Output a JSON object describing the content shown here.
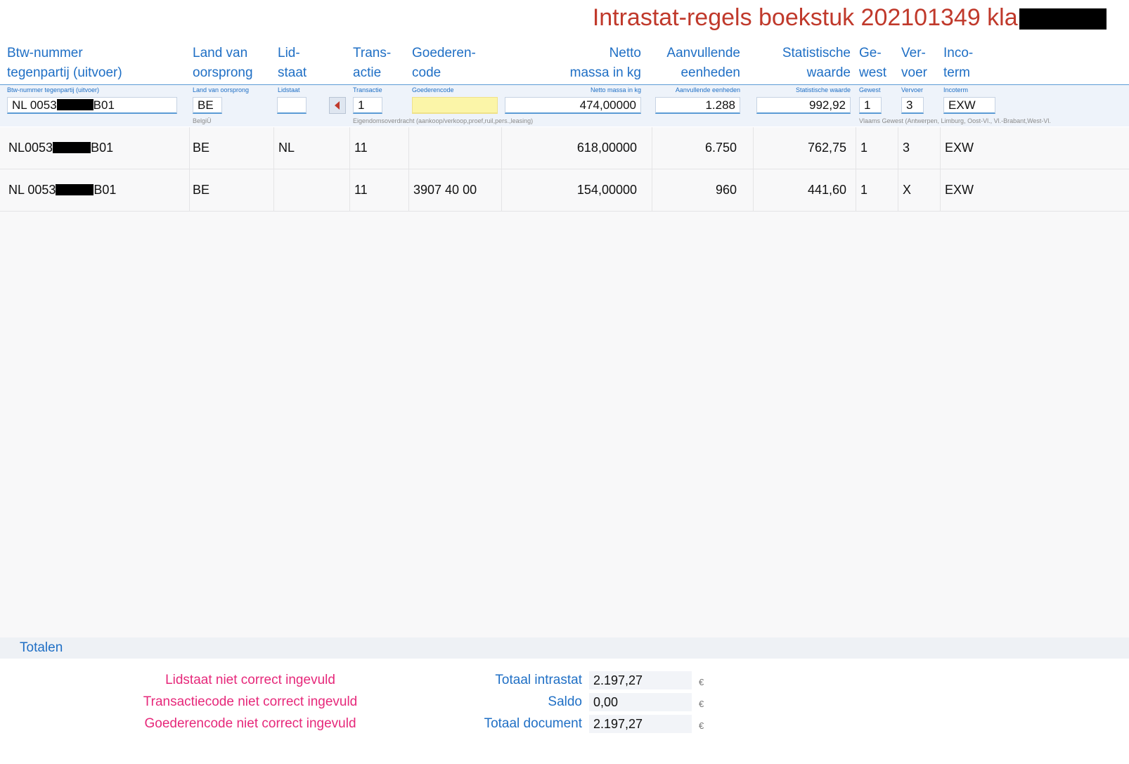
{
  "title": "Intrastat-regels boekstuk 202101349  klant",
  "columns": {
    "btw": {
      "line1": "Btw-nummer",
      "line2": "tegenpartij (uitvoer)",
      "mini": "Btw-nummer tegenpartij (uitvoer)"
    },
    "land": {
      "line1": "Land van",
      "line2": "oorsprong",
      "mini": "Land van oorsprong"
    },
    "lidstaat": {
      "line1": "Lid-",
      "line2": "staat",
      "mini": "Lidstaat"
    },
    "transactie": {
      "line1": "Trans-",
      "line2": "actie",
      "mini": "Transactie"
    },
    "goederencode": {
      "line1": "Goederen-",
      "line2": "code",
      "mini": "Goederencode"
    },
    "netto": {
      "line1": "Netto",
      "line2": "massa in kg",
      "mini": "Netto massa in kg"
    },
    "aanvullende": {
      "line1": "Aanvullende",
      "line2": "eenheden",
      "mini": "Aanvullende eenheden"
    },
    "statistische": {
      "line1": "Statistische",
      "line2": "waarde",
      "mini": "Statistische waarde"
    },
    "gewest": {
      "line1": "Ge-",
      "line2": "west",
      "mini": "Gewest"
    },
    "vervoer": {
      "line1": "Ver-",
      "line2": "voer",
      "mini": "Vervoer"
    },
    "incoterm": {
      "line1": "Inco-",
      "line2": "term",
      "mini": "Incoterm"
    }
  },
  "form": {
    "btw_prefix": "NL 0053",
    "btw_suffix": "B01",
    "land": "BE",
    "lidstaat": "",
    "transactie": "1",
    "goederencode": "",
    "netto": "474,00000",
    "aanvullende": "1.288",
    "statistische": "992,92",
    "gewest": "1",
    "vervoer": "3",
    "incoterm": "EXW",
    "hint_land": "BelgiÜ",
    "hint_transactie": "Eigendomsoverdracht (aankoop/verkoop,proef,ruil,pers.,leasing)",
    "hint_gewest": "Vlaams Gewest (Antwerpen, Limburg, Oost-Vl., Vl.-Brabant,West-Vl."
  },
  "rows": [
    {
      "btw_prefix": "NL0053",
      "btw_suffix": "B01",
      "land": "BE",
      "lidstaat": "NL",
      "transactie": "11",
      "goederencode": "",
      "netto": "618,00000",
      "aanvullende": "6.750",
      "statistische": "762,75",
      "gewest": "1",
      "vervoer": "3",
      "incoterm": "EXW"
    },
    {
      "btw_prefix": "NL 0053",
      "btw_suffix": "B01",
      "land": "BE",
      "lidstaat": "",
      "transactie": "11",
      "goederencode": "3907 40 00",
      "netto": "154,00000",
      "aanvullende": "960",
      "statistische": "441,60",
      "gewest": "1",
      "vervoer": "X",
      "incoterm": "EXW"
    }
  ],
  "totals": {
    "section_label": "Totalen",
    "errors": [
      "Lidstaat niet correct ingevuld",
      "Transactiecode niet correct ingevuld",
      "Goederencode niet correct ingevuld"
    ],
    "totaal_intrastat_label": "Totaal intrastat",
    "totaal_intrastat": "2.197,27",
    "saldo_label": "Saldo",
    "saldo": "0,00",
    "totaal_document_label": "Totaal document",
    "totaal_document": "2.197,27",
    "currency": "€"
  },
  "colors": {
    "title": "#c0392b",
    "header": "#1f6fc5",
    "error": "#e6287a",
    "highlight_field": "#fbf5a8"
  }
}
